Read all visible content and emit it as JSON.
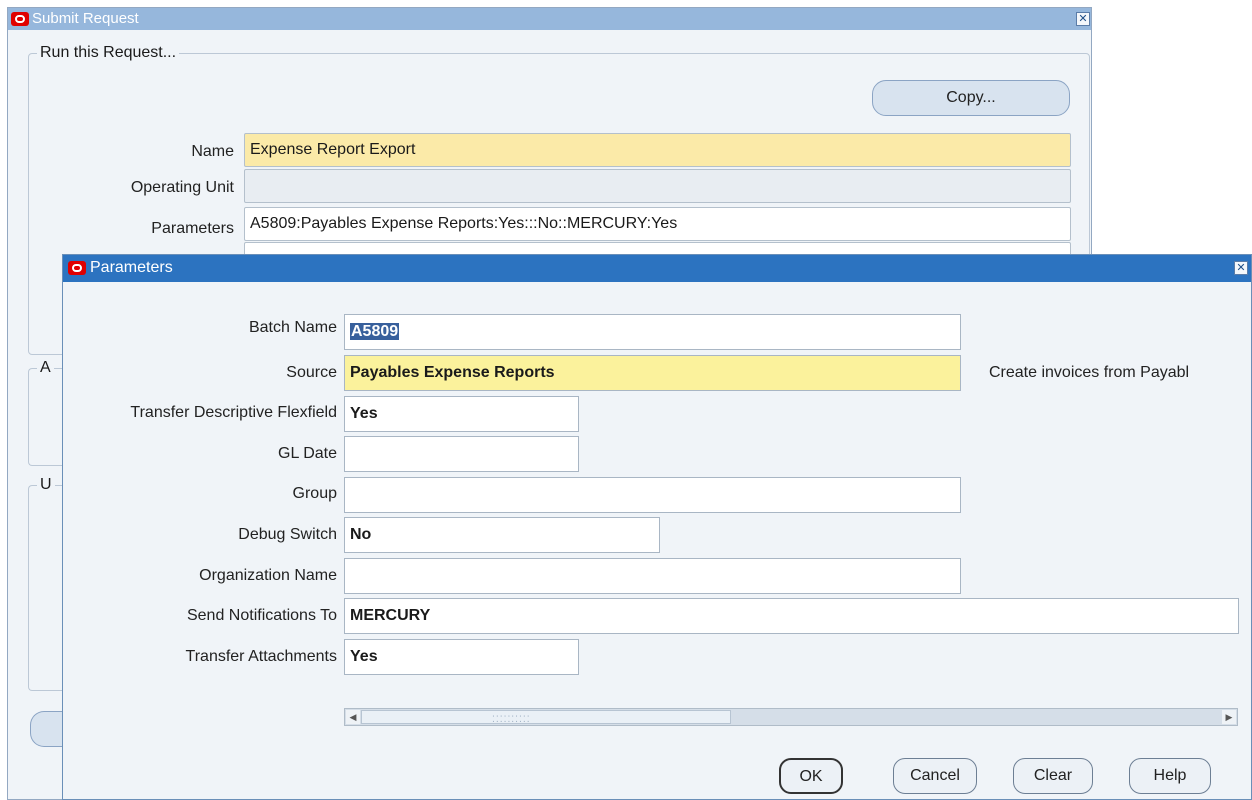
{
  "submit_window": {
    "title": "Submit Request",
    "group_run_label": "Run this Request...",
    "copy_button": "Copy...",
    "name_label": "Name",
    "name_value": "Expense Report Export",
    "operating_unit_label": "Operating Unit",
    "operating_unit_value": "",
    "parameters_label": "Parameters",
    "parameters_value": "A5809:Payables Expense Reports:Yes:::No::MERCURY:Yes",
    "group_a_letter": "A",
    "group_u_letter": "U"
  },
  "params_window": {
    "title": "Parameters",
    "fields": [
      {
        "label": "Batch Name",
        "value": "A5809"
      },
      {
        "label": "Source",
        "value": "Payables Expense Reports"
      },
      {
        "label": "Transfer Descriptive Flexfield",
        "value": "Yes"
      },
      {
        "label": "GL Date",
        "value": ""
      },
      {
        "label": "Group",
        "value": ""
      },
      {
        "label": "Debug Switch",
        "value": "No"
      },
      {
        "label": "Organization Name",
        "value": ""
      },
      {
        "label": "Send Notifications To",
        "value": "MERCURY"
      },
      {
        "label": "Transfer Attachments",
        "value": "Yes"
      }
    ],
    "source_description": "Create invoices from Payabl",
    "buttons": {
      "ok": "OK",
      "cancel": "Cancel",
      "clear": "Clear",
      "help": "Help"
    }
  },
  "colors": {
    "required_field": "#fbeaa8",
    "active_titlebar": "#2c73c0",
    "inactive_titlebar": "#96b7dc",
    "oracle_red": "#e00000"
  }
}
